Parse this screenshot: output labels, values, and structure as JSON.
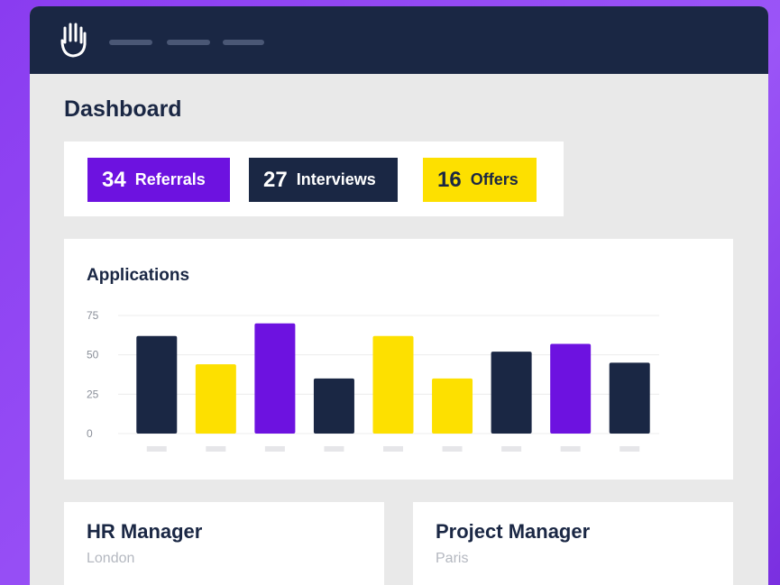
{
  "header": {
    "logo_icon": "hand-icon",
    "nav_placeholders": 3
  },
  "page": {
    "title": "Dashboard"
  },
  "stats": [
    {
      "value": "34",
      "label": "Referrals",
      "color": "#6d12e0"
    },
    {
      "value": "27",
      "label": "Interviews",
      "color": "#1a2744"
    },
    {
      "value": "16",
      "label": "Offers",
      "color": "#fde000"
    }
  ],
  "chart": {
    "title": "Applications"
  },
  "chart_data": {
    "type": "bar",
    "title": "Applications",
    "categories": [
      "",
      "",
      "",
      "",
      "",
      "",
      "",
      "",
      ""
    ],
    "values": [
      62,
      44,
      70,
      35,
      62,
      35,
      52,
      57,
      45
    ],
    "bar_colors": [
      "#1a2744",
      "#fde000",
      "#6d12e0",
      "#1a2744",
      "#fde000",
      "#fde000",
      "#1a2744",
      "#6d12e0",
      "#1a2744"
    ],
    "yticks": [
      "0",
      "25",
      "50",
      "75"
    ],
    "ylim": [
      0,
      75
    ],
    "grid": true,
    "xlabel": "",
    "ylabel": ""
  },
  "jobs": [
    {
      "title": "HR Manager",
      "location": "London"
    },
    {
      "title": "Project Manager",
      "location": "Paris"
    }
  ]
}
